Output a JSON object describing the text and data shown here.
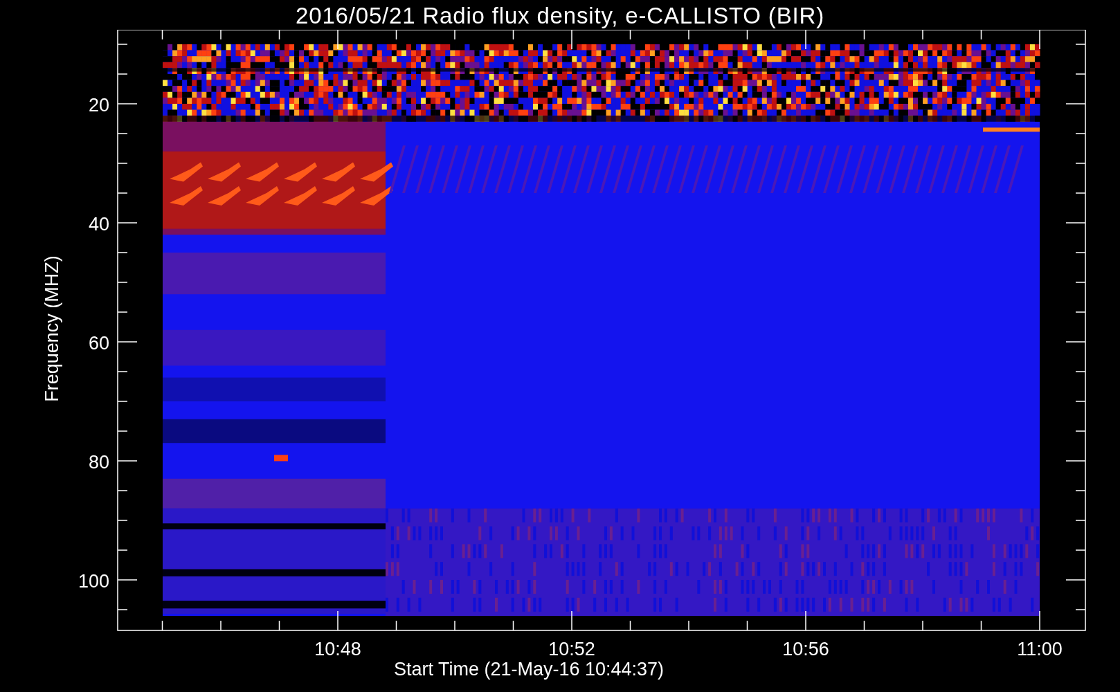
{
  "title": "2016/05/21  Radio flux density, e-CALLISTO (BIR)",
  "y_axis": {
    "label": "Frequency (MHZ)",
    "ticks": [
      "20",
      "40",
      "60",
      "80",
      "100"
    ]
  },
  "x_axis": {
    "label": "Start Time (21-May-16 10:44:37)",
    "ticks": [
      "10:48",
      "10:52",
      "10:56",
      "11:00"
    ]
  }
}
